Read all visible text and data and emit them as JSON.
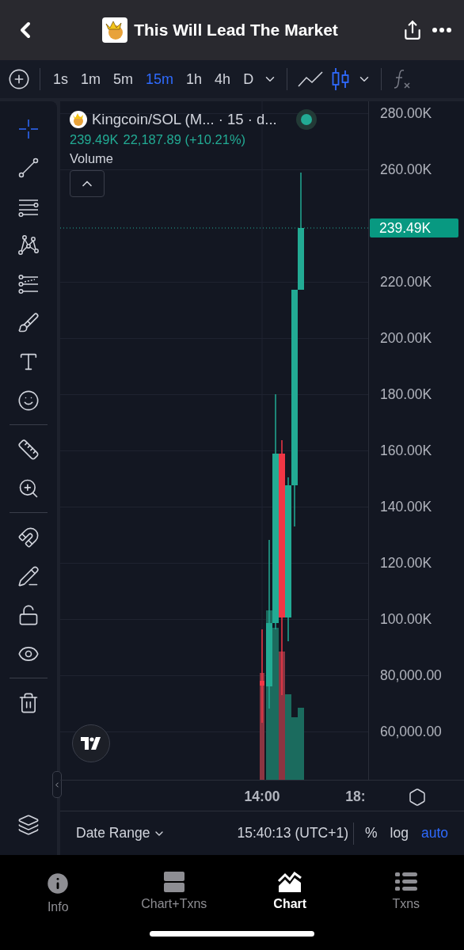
{
  "header": {
    "title": "This Will Lead The Market"
  },
  "toolbar": {
    "intervals": [
      {
        "label": "1s",
        "selected": false
      },
      {
        "label": "1m",
        "selected": false
      },
      {
        "label": "5m",
        "selected": false
      },
      {
        "label": "15m",
        "selected": true
      },
      {
        "label": "1h",
        "selected": false
      },
      {
        "label": "4h",
        "selected": false
      },
      {
        "label": "D",
        "selected": false
      }
    ],
    "chart_types": [
      {
        "kind": "line",
        "selected": false
      },
      {
        "kind": "candles",
        "selected": true
      }
    ]
  },
  "tools": [
    [
      {
        "kind": "crosshair",
        "selected": true
      },
      {
        "kind": "trend-line",
        "selected": false
      },
      {
        "kind": "parallel-lines",
        "selected": false
      },
      {
        "kind": "pattern",
        "selected": false
      },
      {
        "kind": "fib",
        "selected": false
      },
      {
        "kind": "brush",
        "selected": false
      },
      {
        "kind": "text",
        "selected": false
      },
      {
        "kind": "emoji",
        "selected": false
      }
    ],
    [
      {
        "kind": "ruler",
        "selected": false
      },
      {
        "kind": "zoom",
        "selected": false
      }
    ],
    [
      {
        "kind": "magnet",
        "selected": false
      },
      {
        "kind": "lock-drawing",
        "selected": false
      },
      {
        "kind": "lock",
        "selected": false
      },
      {
        "kind": "eye",
        "selected": false
      }
    ],
    [
      {
        "kind": "trash",
        "selected": false
      }
    ]
  ],
  "legend": {
    "symbol": "Kingcoin/SOL (M... · 15 · d...",
    "live": true,
    "price": "239.49K",
    "change": "22,187.89 (+10.21%)",
    "volume_label": "Volume"
  },
  "price_axis": [
    "280.00K",
    "260.00K",
    "220.00K",
    "200.00K",
    "180.00K",
    "160.00K",
    "140.00K",
    "120.00K",
    "100.00K",
    "80,000.00",
    "60,000.00"
  ],
  "last_price": "239.49K",
  "time_axis": [
    "14:00",
    "18:"
  ],
  "bottom_bar": {
    "date_range": "Date Range",
    "time": "15:40:13 (UTC+1)",
    "scale_options": [
      {
        "label": "%",
        "selected": false
      },
      {
        "label": "log",
        "selected": false
      },
      {
        "label": "auto",
        "selected": true
      }
    ]
  },
  "nav": [
    {
      "kind": "info",
      "label": "Info",
      "selected": false
    },
    {
      "kind": "split",
      "label": "Chart+Txns",
      "selected": false
    },
    {
      "kind": "chart",
      "label": "Chart",
      "selected": true
    },
    {
      "kind": "list",
      "label": "Txns",
      "selected": false
    }
  ]
}
